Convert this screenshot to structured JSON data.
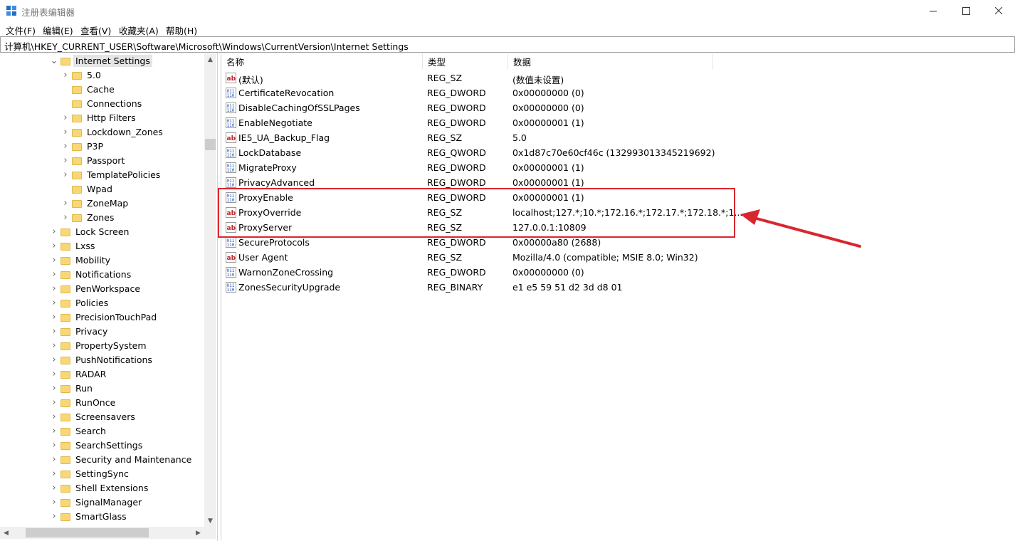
{
  "window": {
    "title": "注册表编辑器"
  },
  "menu": [
    "文件(F)",
    "编辑(E)",
    "查看(V)",
    "收藏夹(A)",
    "帮助(H)"
  ],
  "address": "计算机\\HKEY_CURRENT_USER\\Software\\Microsoft\\Windows\\CurrentVersion\\Internet Settings",
  "tree": {
    "selected": "Internet Settings",
    "children": [
      {
        "label": "5.0",
        "expandable": true
      },
      {
        "label": "Cache",
        "expandable": false
      },
      {
        "label": "Connections",
        "expandable": false
      },
      {
        "label": "Http Filters",
        "expandable": true
      },
      {
        "label": "Lockdown_Zones",
        "expandable": true
      },
      {
        "label": "P3P",
        "expandable": true
      },
      {
        "label": "Passport",
        "expandable": true
      },
      {
        "label": "TemplatePolicies",
        "expandable": true
      },
      {
        "label": "Wpad",
        "expandable": false
      },
      {
        "label": "ZoneMap",
        "expandable": true
      },
      {
        "label": "Zones",
        "expandable": true
      }
    ],
    "siblings": [
      {
        "label": "Lock Screen",
        "expandable": true
      },
      {
        "label": "Lxss",
        "expandable": true
      },
      {
        "label": "Mobility",
        "expandable": true
      },
      {
        "label": "Notifications",
        "expandable": true
      },
      {
        "label": "PenWorkspace",
        "expandable": true
      },
      {
        "label": "Policies",
        "expandable": true
      },
      {
        "label": "PrecisionTouchPad",
        "expandable": true
      },
      {
        "label": "Privacy",
        "expandable": true
      },
      {
        "label": "PropertySystem",
        "expandable": true
      },
      {
        "label": "PushNotifications",
        "expandable": true
      },
      {
        "label": "RADAR",
        "expandable": true
      },
      {
        "label": "Run",
        "expandable": true
      },
      {
        "label": "RunOnce",
        "expandable": true
      },
      {
        "label": "Screensavers",
        "expandable": true
      },
      {
        "label": "Search",
        "expandable": true
      },
      {
        "label": "SearchSettings",
        "expandable": true
      },
      {
        "label": "Security and Maintenance",
        "expandable": true
      },
      {
        "label": "SettingSync",
        "expandable": true
      },
      {
        "label": "Shell Extensions",
        "expandable": true
      },
      {
        "label": "SignalManager",
        "expandable": true
      },
      {
        "label": "SmartGlass",
        "expandable": true
      }
    ]
  },
  "columns": {
    "name": "名称",
    "type": "类型",
    "data": "数据"
  },
  "values": [
    {
      "name": "(默认)",
      "type": "REG_SZ",
      "data": "(数值未设置)",
      "icon": "string-value-icon"
    },
    {
      "name": "CertificateRevocation",
      "type": "REG_DWORD",
      "data": "0x00000000 (0)",
      "icon": "binary-value-icon"
    },
    {
      "name": "DisableCachingOfSSLPages",
      "type": "REG_DWORD",
      "data": "0x00000000 (0)",
      "icon": "binary-value-icon"
    },
    {
      "name": "EnableNegotiate",
      "type": "REG_DWORD",
      "data": "0x00000001 (1)",
      "icon": "binary-value-icon"
    },
    {
      "name": "IE5_UA_Backup_Flag",
      "type": "REG_SZ",
      "data": "5.0",
      "icon": "string-value-icon"
    },
    {
      "name": "LockDatabase",
      "type": "REG_QWORD",
      "data": "0x1d87c70e60cf46c (132993013345219692)",
      "icon": "binary-value-icon"
    },
    {
      "name": "MigrateProxy",
      "type": "REG_DWORD",
      "data": "0x00000001 (1)",
      "icon": "binary-value-icon"
    },
    {
      "name": "PrivacyAdvanced",
      "type": "REG_DWORD",
      "data": "0x00000001 (1)",
      "icon": "binary-value-icon"
    },
    {
      "name": "ProxyEnable",
      "type": "REG_DWORD",
      "data": "0x00000001 (1)",
      "icon": "binary-value-icon"
    },
    {
      "name": "ProxyOverride",
      "type": "REG_SZ",
      "data": "localhost;127.*;10.*;172.16.*;172.17.*;172.18.*;1...",
      "icon": "string-value-icon"
    },
    {
      "name": "ProxyServer",
      "type": "REG_SZ",
      "data": "127.0.0.1:10809",
      "icon": "string-value-icon"
    },
    {
      "name": "SecureProtocols",
      "type": "REG_DWORD",
      "data": "0x00000a80 (2688)",
      "icon": "binary-value-icon"
    },
    {
      "name": "User Agent",
      "type": "REG_SZ",
      "data": "Mozilla/4.0 (compatible; MSIE 8.0; Win32)",
      "icon": "string-value-icon"
    },
    {
      "name": "WarnonZoneCrossing",
      "type": "REG_DWORD",
      "data": "0x00000000 (0)",
      "icon": "binary-value-icon"
    },
    {
      "name": "ZonesSecurityUpgrade",
      "type": "REG_BINARY",
      "data": "e1 e5 59 51 d2 3d d8 01",
      "icon": "binary-value-icon"
    }
  ],
  "colors": {
    "highlight": "#d9262e",
    "folder": "#f8d775",
    "selection": "#e5e5e5"
  }
}
